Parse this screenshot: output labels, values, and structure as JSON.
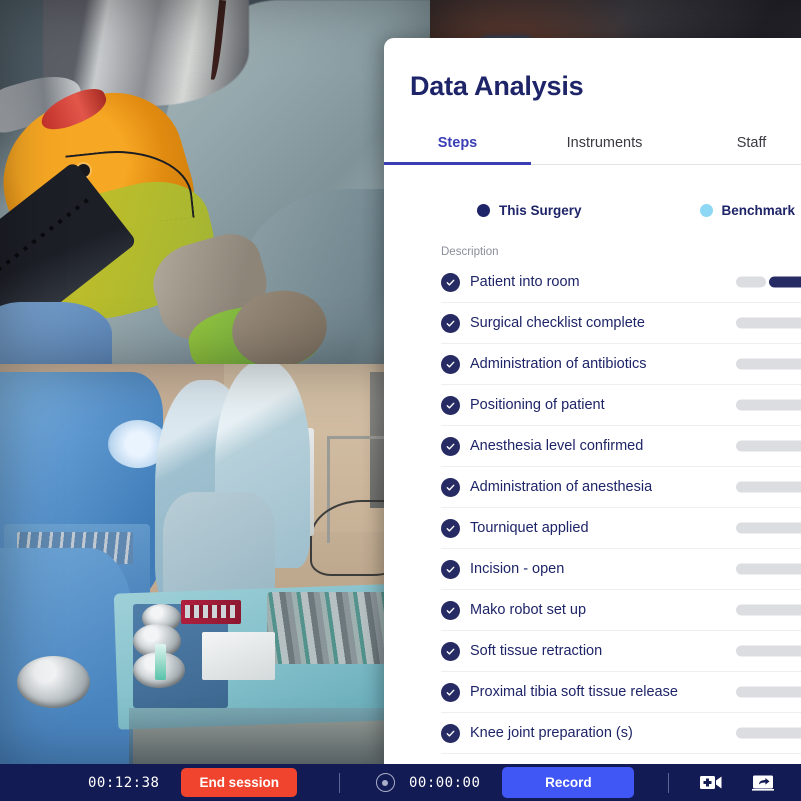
{
  "panel": {
    "title": "Data Analysis",
    "tabs": [
      {
        "label": "Steps",
        "active": true
      },
      {
        "label": "Instruments",
        "active": false
      },
      {
        "label": "Staff",
        "active": false
      }
    ],
    "legend": [
      {
        "label": "This Surgery",
        "color": "#1e2468",
        "icon": "legend-dot-icon"
      },
      {
        "label": "Benchmark",
        "color": "#8ed8f5",
        "icon": "legend-dot-icon"
      }
    ],
    "list_header": "Description",
    "steps": [
      {
        "label": "Patient into room",
        "status": "complete",
        "bench_pct": 22,
        "surgery_pct": 34
      },
      {
        "label": "Surgical checklist complete",
        "status": "complete",
        "bench_pct": 52,
        "surgery_pct": 0
      },
      {
        "label": "Administration of antibiotics",
        "status": "complete",
        "bench_pct": 52,
        "surgery_pct": 0
      },
      {
        "label": "Positioning of patient",
        "status": "complete",
        "bench_pct": 52,
        "surgery_pct": 0
      },
      {
        "label": "Anesthesia level confirmed",
        "status": "complete",
        "bench_pct": 52,
        "surgery_pct": 0
      },
      {
        "label": "Administration of anesthesia",
        "status": "complete",
        "bench_pct": 52,
        "surgery_pct": 0
      },
      {
        "label": "Tourniquet applied",
        "status": "complete",
        "bench_pct": 52,
        "surgery_pct": 0
      },
      {
        "label": "Incision - open",
        "status": "complete",
        "bench_pct": 52,
        "surgery_pct": 0
      },
      {
        "label": "Mako robot set up",
        "status": "complete",
        "bench_pct": 52,
        "surgery_pct": 0
      },
      {
        "label": "Soft tissue retraction",
        "status": "complete",
        "bench_pct": 52,
        "surgery_pct": 0
      },
      {
        "label": "Proximal tibia soft tissue release",
        "status": "complete",
        "bench_pct": 52,
        "surgery_pct": 0
      },
      {
        "label": "Knee joint preparation (s)",
        "status": "complete",
        "bench_pct": 52,
        "surgery_pct": 0
      }
    ]
  },
  "bottom_bar": {
    "session_time": "00:12:38",
    "end_session_label": "End session",
    "record_time": "00:00:00",
    "record_label": "Record",
    "record_indicator_icon": "record-dot-icon",
    "add_camera_icon": "camera-plus-icon",
    "share_screen_icon": "screen-share-icon"
  },
  "colors": {
    "brand_navy": "#1e2468",
    "bar_navy": "#131b54",
    "accent_blue": "#3a3fb5",
    "record_blue": "#4157f5",
    "end_red": "#f0442e",
    "benchmark_blue": "#8ed8f5",
    "track_gray": "#dcdde0"
  }
}
